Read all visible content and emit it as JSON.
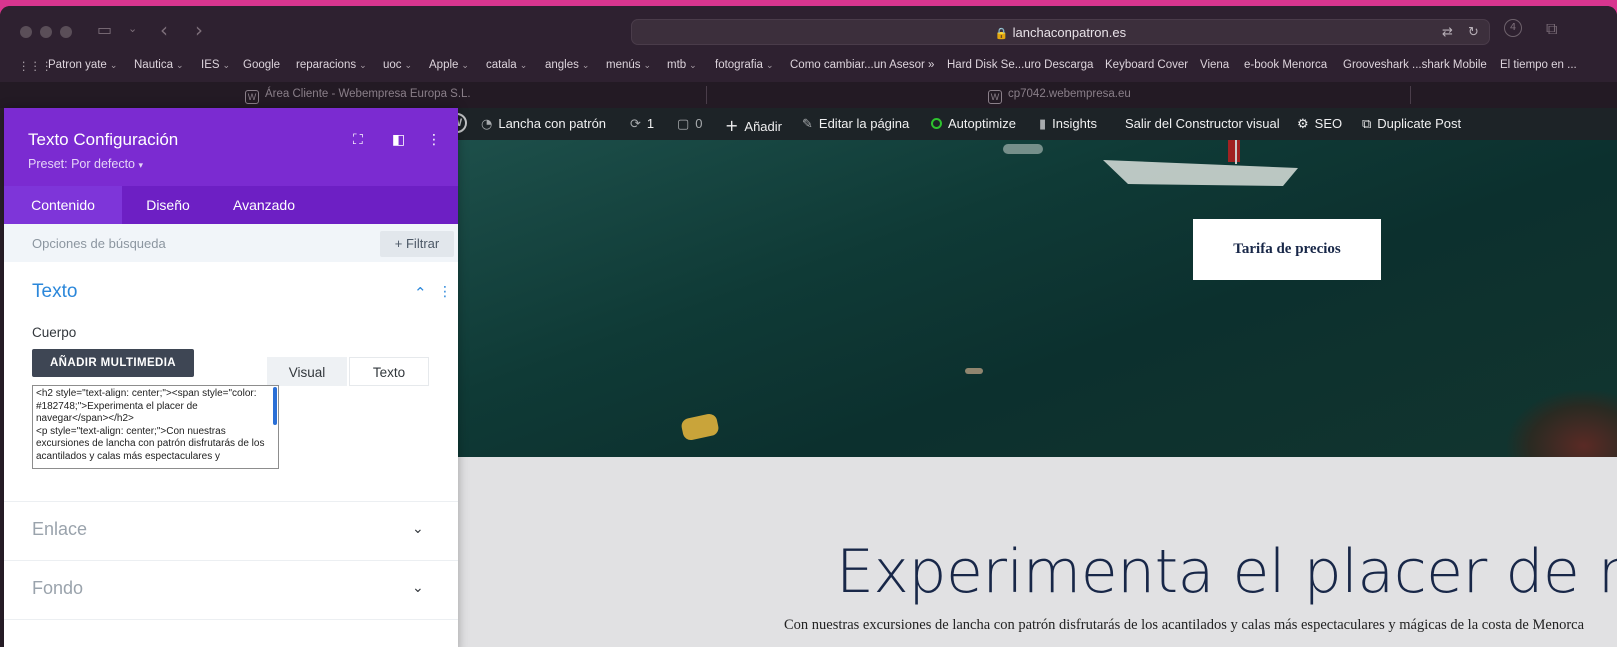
{
  "browser": {
    "url": "lanchaconpatron.es",
    "bookmarks": [
      {
        "label": "Patron yate",
        "folder": true
      },
      {
        "label": "Nautica",
        "folder": true
      },
      {
        "label": "IES",
        "folder": true
      },
      {
        "label": "Google",
        "folder": false
      },
      {
        "label": "reparacions",
        "folder": true
      },
      {
        "label": "uoc",
        "folder": true
      },
      {
        "label": "Apple",
        "folder": true
      },
      {
        "label": "catala",
        "folder": true
      },
      {
        "label": "angles",
        "folder": true
      },
      {
        "label": "menús",
        "folder": true
      },
      {
        "label": "mtb",
        "folder": true
      },
      {
        "label": "fotografia",
        "folder": true
      },
      {
        "label": "Como cambiar...un Asesor »",
        "folder": false
      },
      {
        "label": "Hard Disk Se...uro Descarga",
        "folder": false
      },
      {
        "label": "Keyboard Cover",
        "folder": false
      },
      {
        "label": "Viena",
        "folder": false
      },
      {
        "label": "e-book Menorca",
        "folder": false
      },
      {
        "label": "Grooveshark ...shark Mobile",
        "folder": false
      },
      {
        "label": "El tiempo en ...",
        "folder": false
      }
    ],
    "tabs": [
      {
        "label": "Área Cliente - Webempresa Europa S.L."
      },
      {
        "label": "cp7042.webempresa.eu"
      }
    ]
  },
  "adminbar": {
    "site": "Lancha con patrón",
    "updates": "1",
    "comments": "0",
    "add": "Añadir",
    "edit": "Editar la página",
    "autoptimize": "Autoptimize",
    "insights": "Insights",
    "exit_builder": "Salir del Constructor visual",
    "seo": "SEO",
    "duplicate": "Duplicate Post"
  },
  "panel": {
    "title": "Texto Configuración",
    "preset": "Preset: Por defecto",
    "tabs": [
      "Contenido",
      "Diseño",
      "Avanzado"
    ],
    "search_placeholder": "Opciones de búsqueda",
    "filter": "+ Filtrar",
    "section_texto": "Texto",
    "label_cuerpo": "Cuerpo",
    "add_media": "AÑADIR MULTIMEDIA",
    "editor_tabs": [
      "Visual",
      "Texto"
    ],
    "code": "<h2 style=\"text-align: center;\"><span style=\"color: #182748;\">Experimenta el placer de navegar</span></h2>\n<p style=\"text-align: center;\">Con nuestras excursiones de lancha con patrón disfrutarás de los acantilados y calas más espectaculares y",
    "section_enlace": "Enlace",
    "section_fondo": "Fondo"
  },
  "site": {
    "button_tarifa": "Tarifa de precios",
    "heading": "Experimenta el placer de navegar",
    "paragraph": "Con nuestras excursiones de lancha con patrón disfrutarás de los acantilados y calas más espectaculares y mágicas de la costa de Menorca"
  },
  "colors": {
    "divi_purple": "#7b2bd1",
    "divi_blue": "#2b87da",
    "heading_navy": "#182748",
    "wp_admin": "#1d2327"
  }
}
